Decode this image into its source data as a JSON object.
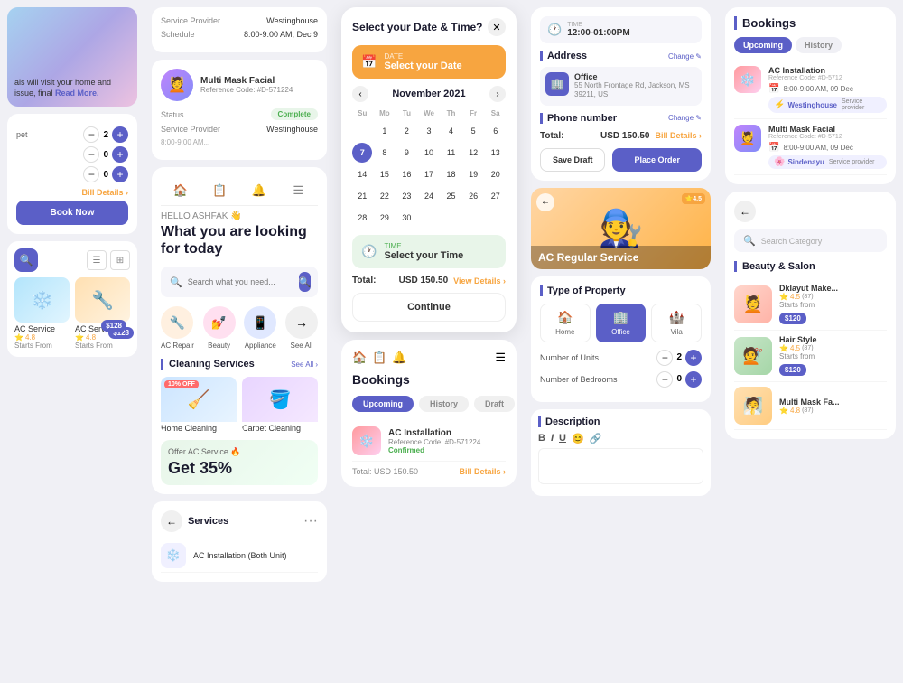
{
  "col1": {
    "overlay_text": "als will visit your home and issue, final",
    "read_more": "Read More.",
    "qty1_val": "2",
    "qty2_val": "0",
    "qty3_val": "0",
    "bill_details": "Bill Details ›",
    "book_now": "Book Now",
    "service1": {
      "name": "AC Service",
      "starts": "Starts From",
      "price": "$128",
      "rating": "4.8",
      "icon": "❄️"
    },
    "service2": {
      "name": "AC Service 2",
      "starts": "Starts From",
      "price": "$128",
      "rating": "4.8",
      "icon": "🔧"
    }
  },
  "col2": {
    "booking1": {
      "label_service_provider": "Service Provider",
      "val_service_provider": "Westinghouse",
      "label_schedule": "Schedule",
      "val_schedule": "8:00-9:00 AM, Dec 9"
    },
    "booking2": {
      "profile_name": "Multi Mask Facial",
      "profile_ref": "Reference Code: #D-571224",
      "label_status": "Status",
      "val_status": "Complete",
      "label_provider": "Service Provider",
      "val_provider": "Westinghouse"
    },
    "nav": [
      "🏠",
      "📋",
      "🔔",
      "☰"
    ],
    "hello": "HELLO ASHFAK 👋",
    "looking": "What you are looking for today",
    "search_placeholder": "Search what you need...",
    "categories": [
      {
        "icon": "🔧",
        "label": "AC Repair",
        "bg": "#fff0e0"
      },
      {
        "icon": "💅",
        "label": "Beauty",
        "bg": "#ffe0f0"
      },
      {
        "icon": "📱",
        "label": "Appliance",
        "bg": "#e0e8ff"
      },
      {
        "icon": "→",
        "label": "See All",
        "bg": "#f0f0f0"
      }
    ],
    "section_cleaning": "Cleaning Services",
    "see_all": "See All ›",
    "cleaning1": {
      "name": "Home Cleaning",
      "discount": "10% OFF",
      "icon": "🧹"
    },
    "cleaning2": {
      "name": "Carpet Cleaning",
      "icon": "🪣"
    },
    "offer_title": "Offer AC Service 🔥",
    "offer_amount": "Get 35%",
    "services_title": "Services",
    "service_item": "AC Installation (Both Unit)"
  },
  "col3": {
    "modal_title": "Select your Date & Time?",
    "date_sub": "DATE",
    "date_main": "Select your Date",
    "cal_month": "November 2021",
    "days_labels": [
      "Su",
      "Mo",
      "Tu",
      "We",
      "Th",
      "Fr",
      "Sa"
    ],
    "week1": [
      "",
      "1",
      "2",
      "3",
      "4",
      "5",
      "6"
    ],
    "week2": [
      "7",
      "8",
      "9",
      "10",
      "11",
      "12",
      "13"
    ],
    "week3": [
      "14",
      "15",
      "16",
      "17",
      "18",
      "19",
      "20"
    ],
    "week4": [
      "21",
      "22",
      "23",
      "24",
      "25",
      "26",
      "27"
    ],
    "week5": [
      "28",
      "29",
      "30",
      "",
      "",
      "",
      ""
    ],
    "active_day": "7",
    "time_sub": "TIME",
    "time_main": "Select your Time",
    "total_label": "Total:",
    "total_amount": "USD 150.50",
    "view_details": "View Details ›",
    "continue": "Continue",
    "bookings_title": "Bookings",
    "tab_upcoming": "Upcoming",
    "tab_history": "History",
    "tab_draft": "Draft",
    "booking_name": "AC Installation",
    "booking_ref": "Reference Code: #D-571224",
    "booking_status": "Confirmed"
  },
  "col4": {
    "time_sub": "TIME",
    "time_val": "12:00-01:00PM",
    "address_title": "Address",
    "change": "Change ✎",
    "office": "Office",
    "office_addr": "55 North Frontage Rd, Jackson, MS 39211, US",
    "phone_title": "Phone number",
    "total_label": "Total:",
    "total_amount": "USD 150.50",
    "bill_details": "Bill Details ›",
    "save_draft": "Save Draft",
    "place_order": "Place Order",
    "ac_badge": "⭐4.5",
    "ac_title": "AC Regular Service",
    "prop_title": "Type of Property",
    "prop_home": "Home",
    "prop_office": "Office",
    "prop_vila": "Vila",
    "units_label": "Number of Units",
    "units_val": "2",
    "bedrooms_label": "Number of Bedrooms",
    "bedrooms_val": "0",
    "desc_title": "Description"
  },
  "col5": {
    "bookings_title": "Bookings",
    "tab_upcoming": "Upcoming",
    "tab_history": "History",
    "booking1": {
      "name": "AC Installation",
      "ref": "Reference Code: #D-5712",
      "schedule": "8:00-9:00 AM, 09 Dec",
      "provider": "Westinghouse",
      "provider_label": "Service provider"
    },
    "booking2": {
      "name": "Multi Mask Facial",
      "ref": "Reference Code: #D-5712",
      "schedule": "8:00-9:00 AM, 09 Dec",
      "provider": "Sindenayu",
      "provider_label": "Service provider"
    },
    "search_cat_placeholder": "Search Category",
    "beauty_title": "Beauty & Salon",
    "beauty1": {
      "name": "Dklayut Make...",
      "sub": "Starts from",
      "price": "$120",
      "rating": "4.5",
      "count": "(87)",
      "icon": "💆"
    },
    "beauty2": {
      "name": "Hair Style",
      "sub": "Starts from",
      "price": "$120",
      "rating": "4.5",
      "count": "(87)",
      "icon": "💇"
    },
    "beauty3": {
      "name": "Multi Mask Fa...",
      "sub": "",
      "price": "",
      "rating": "4.8",
      "count": "(87)",
      "icon": "🧖"
    }
  }
}
